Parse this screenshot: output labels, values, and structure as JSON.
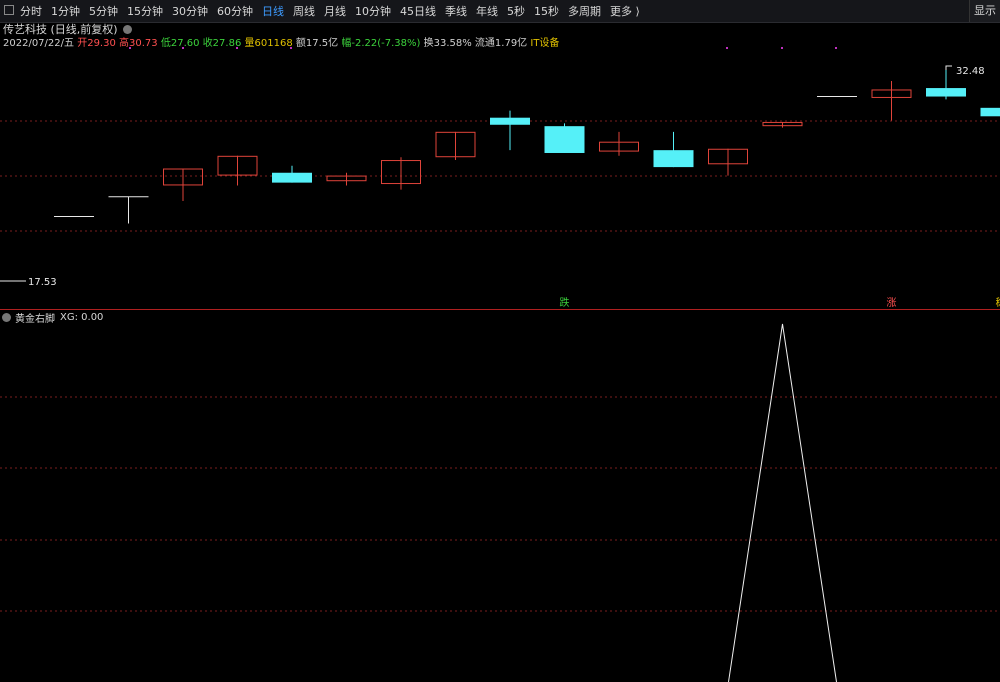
{
  "toolbar": {
    "tabs": [
      "分时",
      "1分钟",
      "5分钟",
      "15分钟",
      "30分钟",
      "60分钟",
      "日线",
      "周线",
      "月线",
      "10分钟",
      "45日线",
      "季线",
      "年线",
      "5秒",
      "15秒",
      "多周期",
      "更多 ⟩"
    ],
    "active": "日线",
    "display_label": "显示"
  },
  "title": "传艺科技 (日线,前复权)",
  "quote": {
    "date": "2022/07/22/五",
    "open": "开29.30",
    "high": "高30.73",
    "low": "低27.60",
    "close": "收27.86",
    "volume": "量601168",
    "amount": "额17.5亿",
    "change": "幅-2.22(-7.38%)",
    "turnover": "换33.58%",
    "float": "流通1.79亿",
    "industry": "IT设备"
  },
  "indicator": {
    "name": "黄金右脚",
    "value": "XG: 0.00"
  },
  "colors": {
    "up": "#e0443a",
    "down": "#55f0f8",
    "grid": "#7a1e1e",
    "divider": "#b02020"
  },
  "chart_data": {
    "type": "candlestick",
    "price_axis": {
      "min": 17.53,
      "max": 32.48
    },
    "markers": {
      "low_label": "17.53",
      "high_label": "32.48"
    },
    "candles": [
      {
        "o": 22.1,
        "c": 22.1,
        "h": 22.1,
        "l": 22.1
      },
      {
        "o": 23.5,
        "c": 23.5,
        "h": 23.5,
        "l": 21.6
      },
      {
        "o": 24.3,
        "c": 25.5,
        "h": 25.5,
        "l": 23.2
      },
      {
        "o": 25.0,
        "c": 26.4,
        "h": 26.4,
        "l": 24.3
      },
      {
        "o": 25.2,
        "c": 24.5,
        "h": 25.7,
        "l": 24.5
      },
      {
        "o": 24.6,
        "c": 25.0,
        "h": 25.2,
        "l": 24.3
      },
      {
        "o": 24.4,
        "c": 26.1,
        "h": 26.3,
        "l": 24.0
      },
      {
        "o": 26.3,
        "c": 28.1,
        "h": 28.1,
        "l": 26.1
      },
      {
        "o": 29.1,
        "c": 28.6,
        "h": 29.6,
        "l": 26.8
      },
      {
        "o": 28.5,
        "c": 26.6,
        "h": 28.7,
        "l": 26.6
      },
      {
        "o": 26.7,
        "c": 27.4,
        "h": 28.1,
        "l": 26.4
      },
      {
        "o": 26.8,
        "c": 25.6,
        "h": 28.1,
        "l": 25.6
      },
      {
        "o": 25.8,
        "c": 26.9,
        "h": 26.9,
        "l": 25.0
      },
      {
        "o": 28.5,
        "c": 28.8,
        "h": 28.8,
        "l": 28.4
      },
      {
        "o": 30.6,
        "c": 30.6,
        "h": 30.6,
        "l": 30.6
      },
      {
        "o": 30.5,
        "c": 31.1,
        "h": 31.7,
        "l": 28.9
      },
      {
        "o": 31.2,
        "c": 30.6,
        "h": 32.48,
        "l": 30.4
      },
      {
        "o": 29.8,
        "c": 29.2,
        "h": 29.8,
        "l": 29.2
      }
    ],
    "signals": [
      {
        "index": 9,
        "label": "跌"
      },
      {
        "index": 15,
        "label": "涨"
      },
      {
        "index": 17,
        "label": "稳"
      }
    ],
    "indicator_series": {
      "name": "XG",
      "values": [
        0,
        0,
        0,
        0,
        0,
        0,
        0,
        0,
        0,
        0,
        0,
        0,
        0,
        1,
        0,
        0,
        0,
        0
      ]
    }
  }
}
